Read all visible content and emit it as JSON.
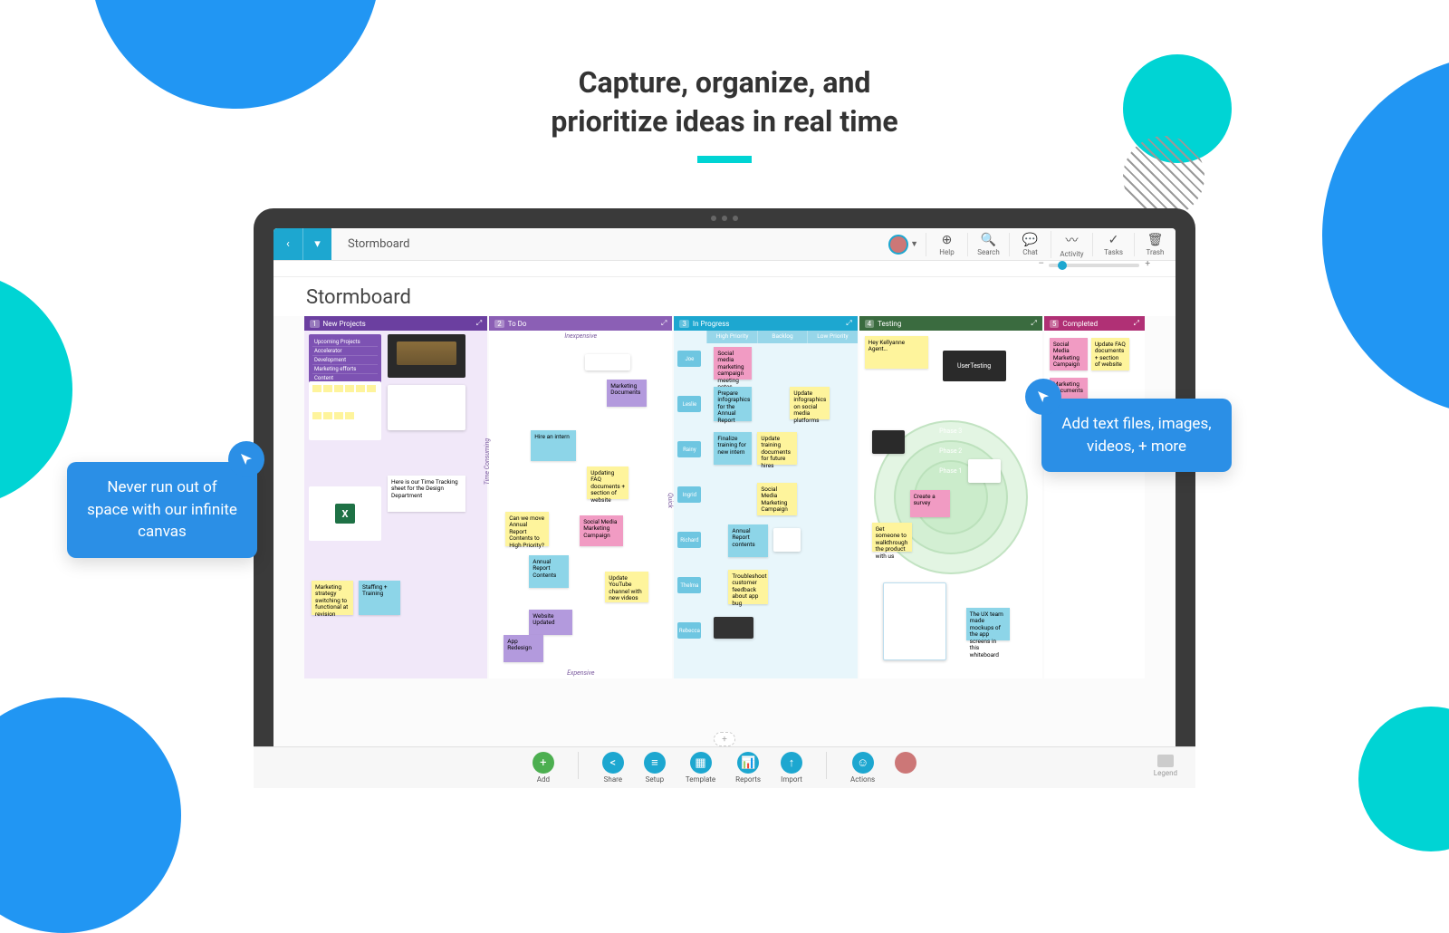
{
  "hero": {
    "line1": "Capture, organize, and",
    "line2": "prioritize ideas in real time"
  },
  "callouts": {
    "left": "Never run out of space with our infinite canvas",
    "right": "Add text files, images, videos, + more"
  },
  "breadcrumb": "Stormboard",
  "toolbar": {
    "help": "Help",
    "search": "Search",
    "chat": "Chat",
    "activity": "Activity",
    "tasks": "Tasks",
    "trash": "Trash"
  },
  "board_title": "Stormboard",
  "sections": {
    "s1": {
      "num": "1",
      "title": "New Projects"
    },
    "s2": {
      "num": "2",
      "title": "To Do"
    },
    "s3": {
      "num": "3",
      "title": "In Progress"
    },
    "s4": {
      "num": "4",
      "title": "Testing"
    },
    "s5": {
      "num": "5",
      "title": "Completed"
    }
  },
  "s2_axes": {
    "top": "Inexpensive",
    "bottom": "Expensive",
    "left": "Time Consuming",
    "right": "Quick"
  },
  "s3_cols": {
    "a": "High Priority",
    "b": "Backlog",
    "c": "Low Priority"
  },
  "swimlanes": [
    "Joe",
    "Leslie",
    "Rainy",
    "Ingrid",
    "Richard",
    "Thelma",
    "Rebecca"
  ],
  "stickies": {
    "s1_timesheet": "Here is our Time Tracking sheet for the Design Department",
    "s1_staffing": "Staffing + Training",
    "s1_marketing": "Marketing strategy switching to functional at revision",
    "s2_mktdocs": "Marketing Documents",
    "s2_hire": "Hire an intern",
    "s2_faq": "Updating FAQ documents + section of website",
    "s2_report": "Can we move Annual Report Contents to High Priority?",
    "s2_smm": "Social Media Marketing Campaign",
    "s2_arc": "Annual Report Contents",
    "s2_yt": "Update YouTube channel with new videos",
    "s2_web": "Website Updated",
    "s2_app": "App Redesign",
    "s3_sm": "Social media marketing campaign meeting notes",
    "s3_info": "Prepare infographics for the Annual Report",
    "s3_train": "Finalize training for new intern",
    "s3_arc": "Annual Report contents",
    "s3_trouble": "Troubleshoot customer feedback about app bug",
    "s3_upinfo": "Update infographics on social media platforms",
    "s3_uptrain": "Update training documents for future hires",
    "s3_smm2": "Social Media Marketing Campaign",
    "s4_survey": "Create a survey",
    "s4_walk": "Get someone to walkthrough the product with us",
    "s4_usertest": "UserTesting",
    "s4_mockups": "The UX team made mockups of the app screens in this whiteboard",
    "s4_phase3": "Phase 3",
    "s4_phase2": "Phase 2",
    "s4_phase1": "Phase 1",
    "s4_kellyanne": "Hey Kellyanne Agent…",
    "s5_smm": "Social Media Marketing Campaign",
    "s5_faq": "Update FAQ documents + section of website",
    "s5_mkt": "Marketing Documents"
  },
  "bottombar": {
    "add": "Add",
    "share": "Share",
    "setup": "Setup",
    "template": "Template",
    "reports": "Reports",
    "import": "Import",
    "actions": "Actions",
    "legend": "Legend"
  }
}
